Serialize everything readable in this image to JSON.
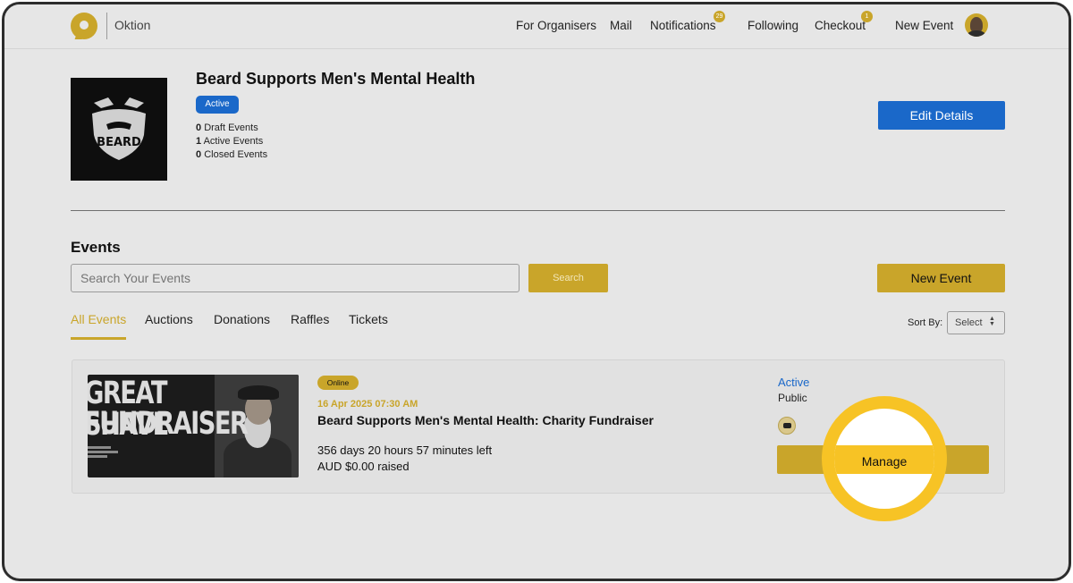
{
  "header": {
    "brand": "Oktion",
    "nav": [
      {
        "label": "For Organisers"
      },
      {
        "label": "Mail"
      },
      {
        "label": "Notifications",
        "badge": "29"
      },
      {
        "label": "Following"
      },
      {
        "label": "Checkout",
        "badge": "1"
      },
      {
        "label": "New Event"
      }
    ]
  },
  "organiser": {
    "name": "Beard Supports Men's Mental Health",
    "status": "Active",
    "logo_text": "BEARD",
    "counts": [
      {
        "value": "0",
        "label": "Draft Events"
      },
      {
        "value": "1",
        "label": "Active Events"
      },
      {
        "value": "0",
        "label": "Closed Events"
      }
    ],
    "edit_label": "Edit Details"
  },
  "events": {
    "title": "Events",
    "search_placeholder": "Search Your Events",
    "search_label": "Search",
    "new_event_label": "New Event",
    "tabs": [
      "All Events",
      "Auctions",
      "Donations",
      "Raffles",
      "Tickets"
    ],
    "active_tab": "All Events",
    "sort_label": "Sort By:",
    "sort_value": "Select",
    "list": [
      {
        "thumbnail_lines": [
          "GREAT SHAVE",
          "FUNDRAISER"
        ],
        "mode": "Online",
        "date": "16 Apr 2025 07:30 AM",
        "title": "Beard Supports Men's Mental Health: Charity Fundraiser",
        "time_left": "356 days 20 hours 57 minutes left",
        "raised": "AUD $0.00 raised",
        "status": "Active",
        "visibility": "Public",
        "manage_label": "Manage"
      }
    ]
  },
  "colors": {
    "accent": "#c9a52a",
    "primary_blue": "#1a68c9",
    "highlight": "#f7c325"
  }
}
